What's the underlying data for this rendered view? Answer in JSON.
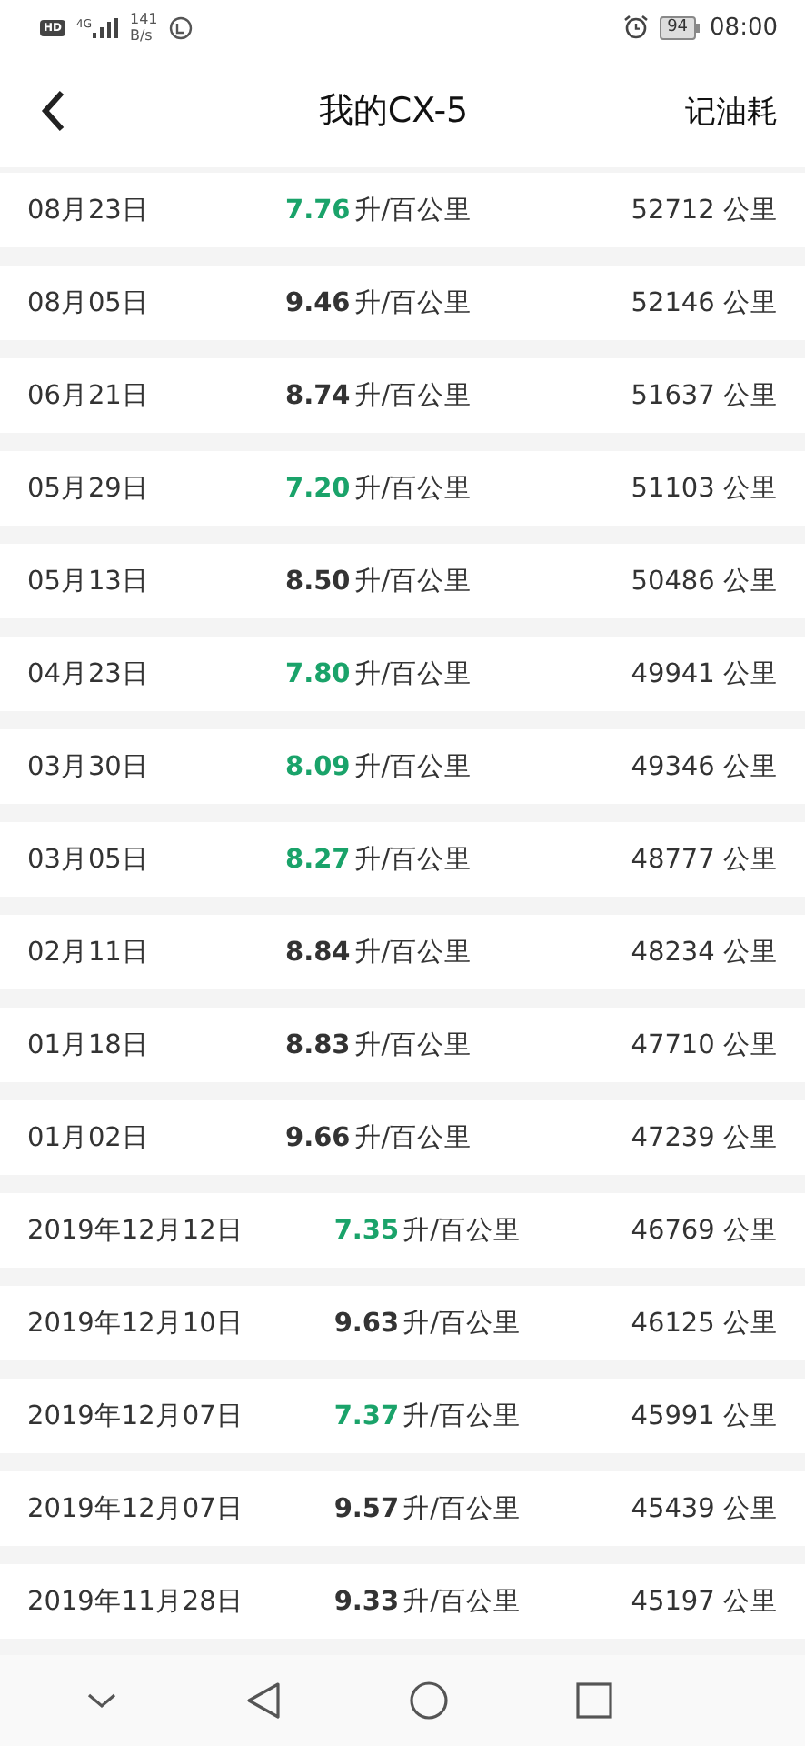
{
  "status_bar": {
    "hd": "HD",
    "network": "4G",
    "speed": "141",
    "speed_unit": "B/s",
    "battery": "94",
    "time": "08:00"
  },
  "header": {
    "title": "我的CX-5",
    "action": "记油耗"
  },
  "records": [
    {
      "date": "08月23日",
      "value": "7.76",
      "unit": "升/百公里",
      "odometer": "52712 公里",
      "good": true
    },
    {
      "date": "08月05日",
      "value": "9.46",
      "unit": "升/百公里",
      "odometer": "52146 公里",
      "good": false
    },
    {
      "date": "06月21日",
      "value": "8.74",
      "unit": "升/百公里",
      "odometer": "51637 公里",
      "good": false
    },
    {
      "date": "05月29日",
      "value": "7.20",
      "unit": "升/百公里",
      "odometer": "51103 公里",
      "good": true
    },
    {
      "date": "05月13日",
      "value": "8.50",
      "unit": "升/百公里",
      "odometer": "50486 公里",
      "good": false
    },
    {
      "date": "04月23日",
      "value": "7.80",
      "unit": "升/百公里",
      "odometer": "49941 公里",
      "good": true
    },
    {
      "date": "03月30日",
      "value": "8.09",
      "unit": "升/百公里",
      "odometer": "49346 公里",
      "good": true
    },
    {
      "date": "03月05日",
      "value": "8.27",
      "unit": "升/百公里",
      "odometer": "48777 公里",
      "good": true
    },
    {
      "date": "02月11日",
      "value": "8.84",
      "unit": "升/百公里",
      "odometer": "48234 公里",
      "good": false
    },
    {
      "date": "01月18日",
      "value": "8.83",
      "unit": "升/百公里",
      "odometer": "47710 公里",
      "good": false
    },
    {
      "date": "01月02日",
      "value": "9.66",
      "unit": "升/百公里",
      "odometer": "47239 公里",
      "good": false
    },
    {
      "date": "2019年12月12日",
      "value": "7.35",
      "unit": "升/百公里",
      "odometer": "46769 公里",
      "good": true
    },
    {
      "date": "2019年12月10日",
      "value": "9.63",
      "unit": "升/百公里",
      "odometer": "46125 公里",
      "good": false
    },
    {
      "date": "2019年12月07日",
      "value": "7.37",
      "unit": "升/百公里",
      "odometer": "45991 公里",
      "good": true
    },
    {
      "date": "2019年12月07日",
      "value": "9.57",
      "unit": "升/百公里",
      "odometer": "45439 公里",
      "good": false
    },
    {
      "date": "2019年11月28日",
      "value": "9.33",
      "unit": "升/百公里",
      "odometer": "45197 公里",
      "good": false
    }
  ]
}
